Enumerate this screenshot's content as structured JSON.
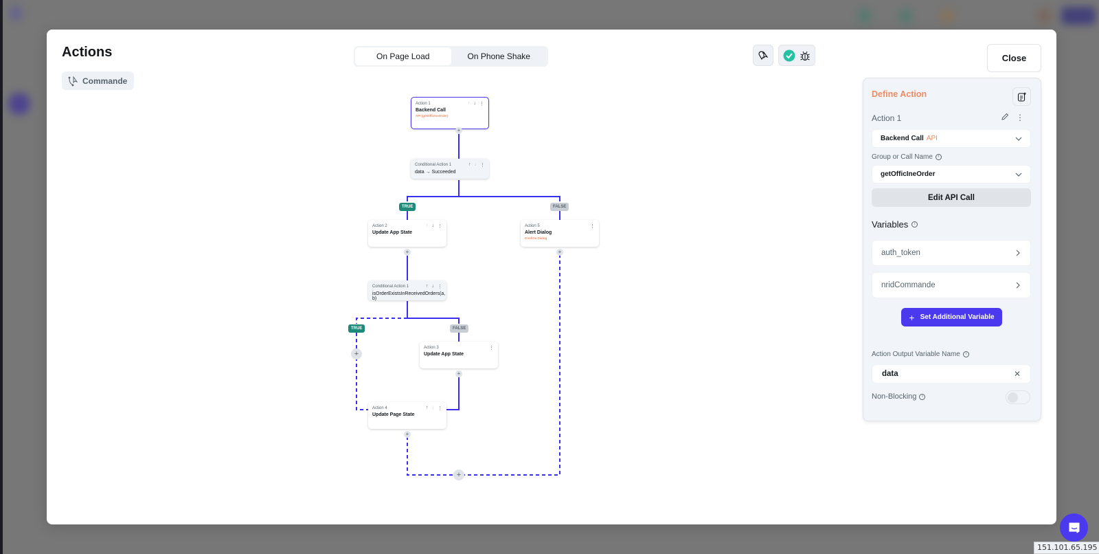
{
  "modal": {
    "title": "Actions",
    "chip_label": "Commande",
    "close_label": "Close",
    "trigger_tabs": [
      {
        "label": "On Page Load",
        "active": true
      },
      {
        "label": "On Phone Shake",
        "active": false
      }
    ],
    "toolbar_icons": [
      "widget-pointer-icon",
      "check-circle-icon",
      "bug-icon"
    ]
  },
  "flow": {
    "nodes": [
      {
        "id": "a1",
        "label": "Action 1",
        "title": "Backend Call",
        "sub": "API (getOfficIneOrder)",
        "selected": true
      },
      {
        "id": "c1",
        "label": "Conditional Action 1",
        "title": "data → Succeeded"
      },
      {
        "id": "a2",
        "label": "Action 2",
        "title": "Update App State"
      },
      {
        "id": "a5",
        "label": "Action 5",
        "title": "Alert Dialog",
        "sub": "Confirm Dialog"
      },
      {
        "id": "c2",
        "label": "Conditional Action 1",
        "title": "isOrderExistsInReceivedOrders(a, b)"
      },
      {
        "id": "a3",
        "label": "Action 3",
        "title": "Update App State"
      },
      {
        "id": "a4",
        "label": "Action 4",
        "title": "Update Page State"
      }
    ],
    "badges": {
      "true": "TRUE",
      "false": "FALSE"
    },
    "plus": "+",
    "colors": {
      "wire": "#3a2ff0",
      "true_badge": "#1d8a7a",
      "false_badge": "#c8cdd3",
      "accent": "#4b39ef",
      "orange": "#ee8b60"
    }
  },
  "panel": {
    "title": "Define Action",
    "action_name": "Action 1",
    "action_type": "Backend Call",
    "action_type_tag": "API",
    "group_label": "Group or Call Name",
    "group_value": "getOfficIneOrder",
    "edit_api_label": "Edit API Call",
    "variables_title": "Variables",
    "variables": [
      "auth_token",
      "nridCommande"
    ],
    "set_var_label": "Set Additional Variable",
    "output_label": "Action Output Variable Name",
    "output_value": "data",
    "non_blocking_label": "Non-Blocking",
    "non_blocking": false
  },
  "footer": {
    "ip": "151.101.65.195"
  }
}
